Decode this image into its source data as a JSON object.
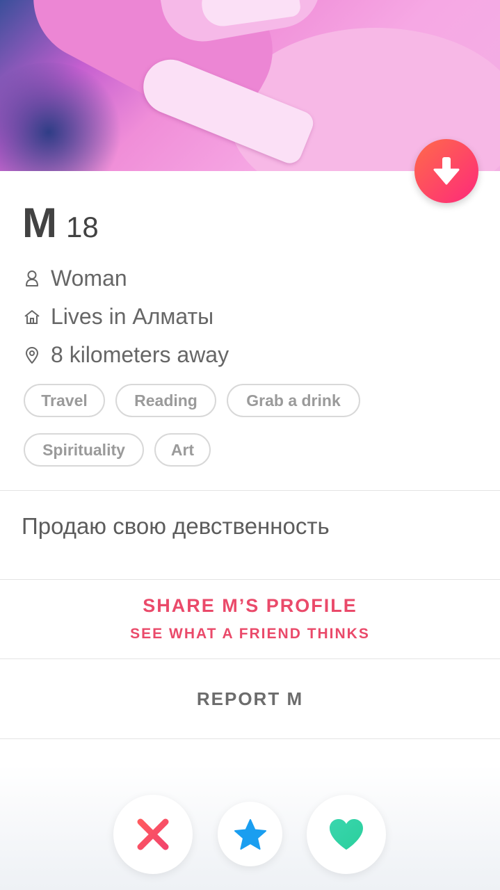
{
  "profile": {
    "name": "M",
    "age": "18",
    "gender": "Woman",
    "lives_in": "Lives in Алматы",
    "distance": "8 kilometers away",
    "interests": [
      "Travel",
      "Reading",
      "Grab a drink",
      "Spirituality",
      "Art"
    ],
    "bio": "Продаю свою девственность"
  },
  "share": {
    "title": "SHARE M’S PROFILE",
    "subtitle": "SEE WHAT A FRIEND THINKS"
  },
  "report": {
    "label": "REPORT M"
  },
  "icons": {
    "collapse": "arrow-down-icon",
    "gender": "person-icon",
    "home": "home-icon",
    "location": "location-pin-icon",
    "nope": "x-icon",
    "superlike": "star-icon",
    "like": "heart-icon"
  },
  "colors": {
    "brand_gradient_start": "#ff6b4a",
    "brand_gradient_end": "#fd297b",
    "share_text": "#ea4a6a",
    "nope": "#f24a62",
    "superlike": "#1a9ef0",
    "like": "#39d6ae"
  }
}
